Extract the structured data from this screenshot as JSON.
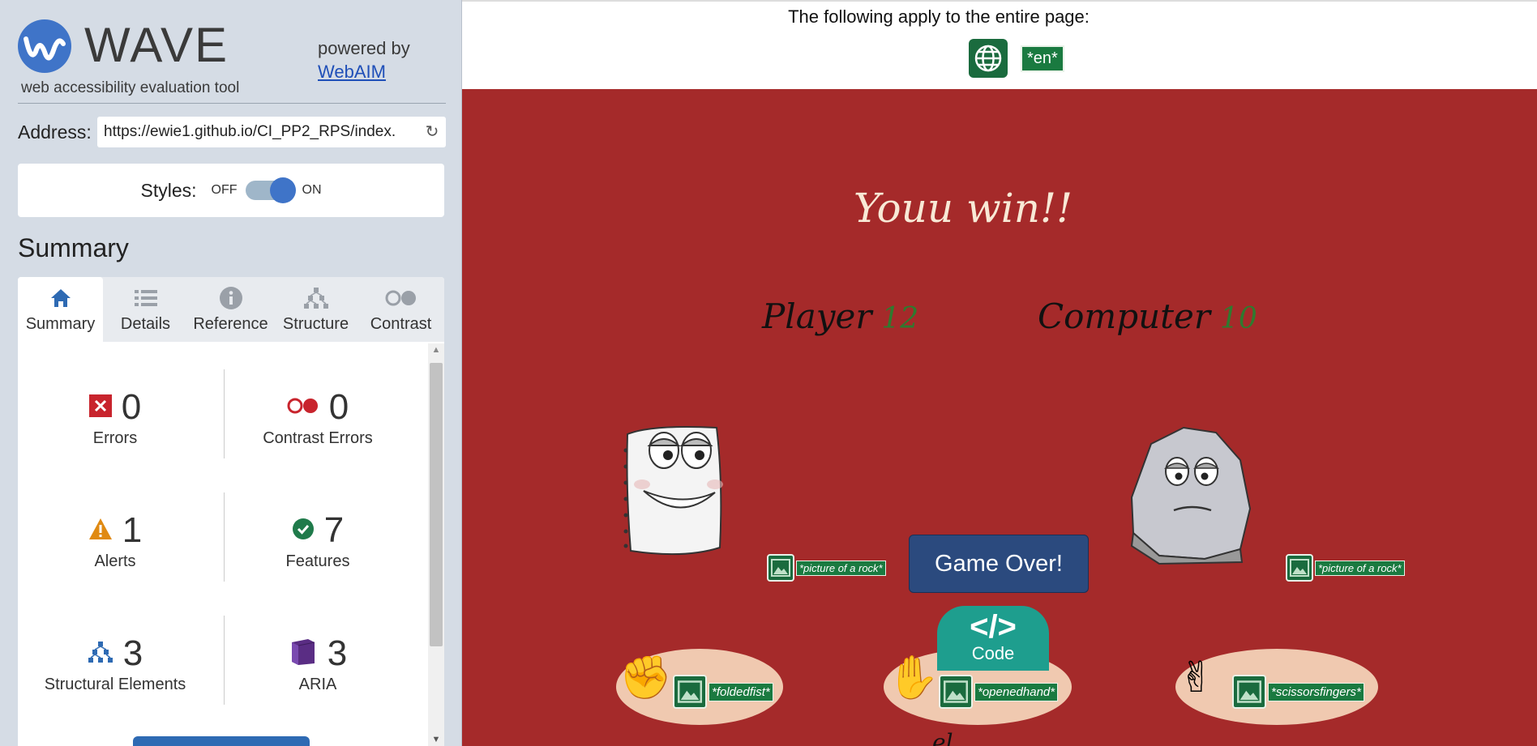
{
  "wave": {
    "title": "WAVE",
    "tagline": "web accessibility evaluation tool",
    "powered_by": "powered by",
    "webaim": "WebAIM",
    "address_label": "Address:",
    "address_value": "https://ewie1.github.io/CI_PP2_RPS/index.",
    "styles_label": "Styles:",
    "styles_off": "OFF",
    "styles_on": "ON",
    "summary_heading": "Summary",
    "tabs": [
      {
        "label": "Summary",
        "icon": "home-icon"
      },
      {
        "label": "Details",
        "icon": "list-icon"
      },
      {
        "label": "Reference",
        "icon": "info-icon"
      },
      {
        "label": "Structure",
        "icon": "hierarchy-icon"
      },
      {
        "label": "Contrast",
        "icon": "contrast-icon"
      }
    ],
    "stats": {
      "errors": {
        "count": "0",
        "label": "Errors"
      },
      "contrast_errors": {
        "count": "0",
        "label": "Contrast Errors"
      },
      "alerts": {
        "count": "1",
        "label": "Alerts"
      },
      "features": {
        "count": "7",
        "label": "Features"
      },
      "structural": {
        "count": "3",
        "label": "Structural Elements"
      },
      "aria": {
        "count": "3",
        "label": "ARIA"
      }
    }
  },
  "page": {
    "notice": "The following apply to the entire page:",
    "lang_tag": "*en*",
    "result": "Youu win!!",
    "player_label": "Player",
    "player_score": "12",
    "computer_label": "Computer",
    "computer_score": "10",
    "rock_alt_1": "*picture of a rock*",
    "rock_alt_2": "*picture of a rock*",
    "game_over": "Game Over!",
    "choices": [
      {
        "alt": "*foldedfist*"
      },
      {
        "alt": "*openedhand*"
      },
      {
        "alt": "*scissorsfingers*"
      }
    ],
    "partial_text": "el",
    "code_glyph": "</>",
    "code_label": "Code"
  },
  "colors": {
    "wave_blue": "#3f74c8",
    "game_bg": "#a52a2a",
    "wave_green": "#1a7a40",
    "button_navy": "#2b4a7e",
    "code_teal": "#1e9e8e"
  }
}
